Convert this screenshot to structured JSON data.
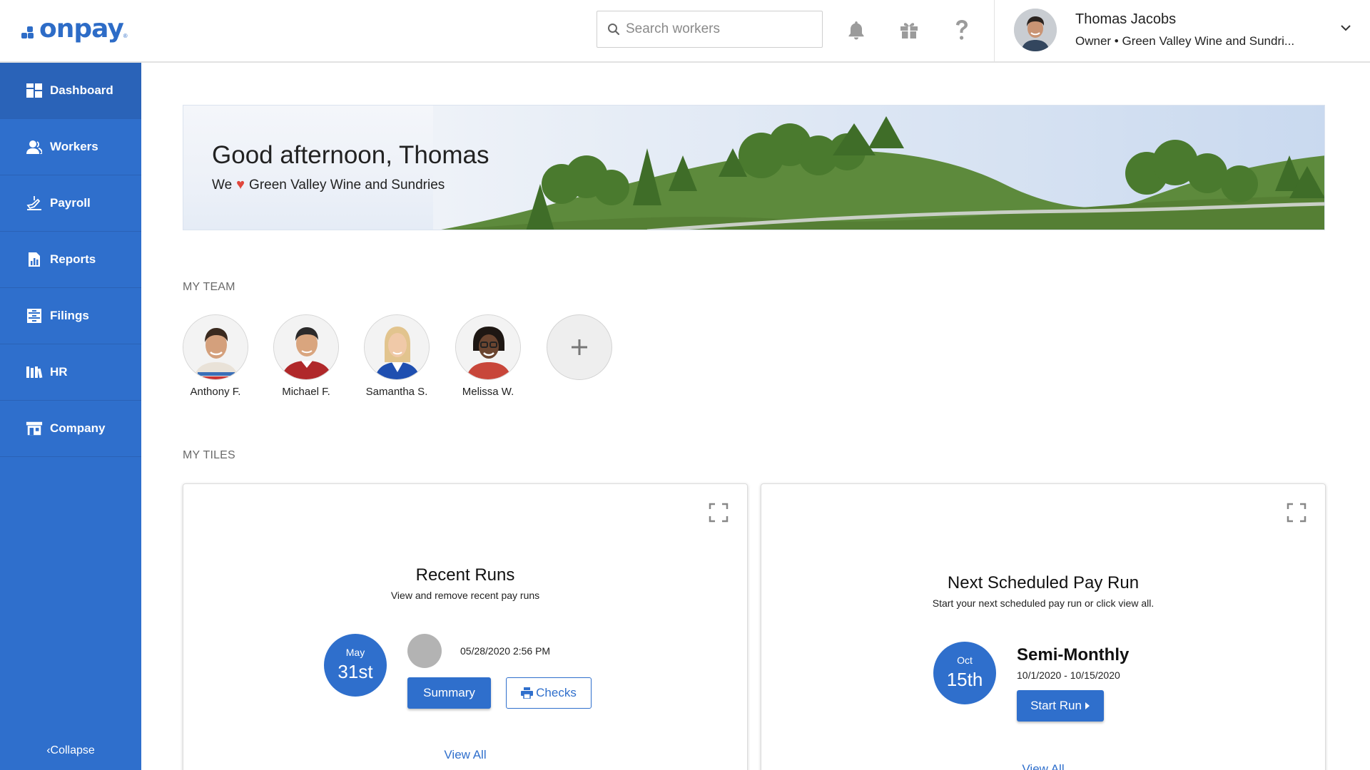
{
  "header": {
    "logo_text": "onpay",
    "logo_mark": "®",
    "search_placeholder": "Search workers",
    "icons": [
      "search-icon",
      "bell-icon",
      "gift-icon",
      "help-icon",
      "chevron-down-icon"
    ],
    "user": {
      "name": "Thomas Jacobs",
      "role": "Owner • Green Valley Wine and Sundri..."
    }
  },
  "sidebar": {
    "items": [
      {
        "label": "Dashboard",
        "icon": "dashboard-icon",
        "active": true
      },
      {
        "label": "Workers",
        "icon": "workers-icon"
      },
      {
        "label": "Payroll",
        "icon": "payroll-icon"
      },
      {
        "label": "Reports",
        "icon": "reports-icon"
      },
      {
        "label": "Filings",
        "icon": "filings-icon"
      },
      {
        "label": "HR",
        "icon": "hr-icon"
      },
      {
        "label": "Company",
        "icon": "company-icon"
      }
    ],
    "collapse_label": "Collapse"
  },
  "banner": {
    "greeting": "Good afternoon, Thomas",
    "tagline_prefix": "We",
    "tagline_company": "Green Valley Wine and Sundries"
  },
  "team": {
    "label": "MY TEAM",
    "members": [
      {
        "name": "Anthony F."
      },
      {
        "name": "Michael F."
      },
      {
        "name": "Samantha S."
      },
      {
        "name": "Melissa W."
      }
    ]
  },
  "tiles": {
    "label": "MY TILES",
    "recent_runs": {
      "title": "Recent Runs",
      "subtitle": "View and remove recent pay runs",
      "month": "May",
      "day": "31st",
      "timestamp": "05/28/2020 2:56 PM",
      "summary_label": "Summary",
      "checks_label": "Checks",
      "view_all": "View All"
    },
    "next_run": {
      "title": "Next Scheduled Pay Run",
      "subtitle": "Start your next scheduled pay run or click view all.",
      "month": "Oct",
      "day": "15th",
      "frequency": "Semi-Monthly",
      "period": "10/1/2020 - 10/15/2020",
      "start_label": "Start Run",
      "view_all": "View All"
    }
  },
  "colors": {
    "brand": "#2f6fcc",
    "sidebar": "#2f6fcc",
    "heart": "#e0463c"
  }
}
